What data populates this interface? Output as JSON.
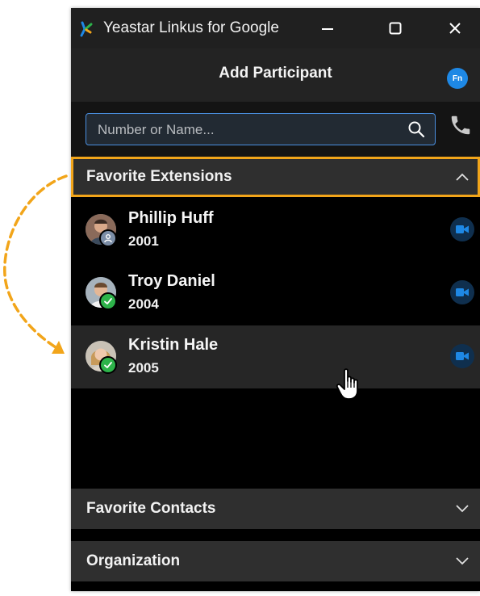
{
  "window": {
    "title": "Yeastar Linkus for Google",
    "controls": [
      "minimize-icon",
      "maximize-icon",
      "close-icon"
    ]
  },
  "header": {
    "title": "Add Participant",
    "badge": "Fn"
  },
  "search": {
    "placeholder": "Number or Name...",
    "value": "",
    "icon": "search-icon",
    "dial_icon": "phone-icon"
  },
  "sections": {
    "favorite_extensions": {
      "label": "Favorite Extensions",
      "state": "expanded",
      "chevron": "chevron-up-icon"
    },
    "favorite_contacts": {
      "label": "Favorite Contacts",
      "state": "collapsed",
      "chevron": "chevron-down-icon"
    },
    "organization": {
      "label": "Organization",
      "state": "collapsed",
      "chevron": "chevron-down-icon"
    }
  },
  "contacts": [
    {
      "name": "Phillip Huff",
      "ext": "2001",
      "status": "away",
      "status_icon": "person-icon"
    },
    {
      "name": "Troy Daniel",
      "ext": "2004",
      "status": "available",
      "status_icon": "check-icon"
    },
    {
      "name": "Kristin Hale",
      "ext": "2005",
      "status": "available",
      "status_icon": "check-icon"
    }
  ],
  "colors": {
    "accent": "#1e88e5",
    "highlight": "#f2a51a",
    "available": "#2db34a",
    "away": "#7b8da6",
    "background": "#000000"
  }
}
